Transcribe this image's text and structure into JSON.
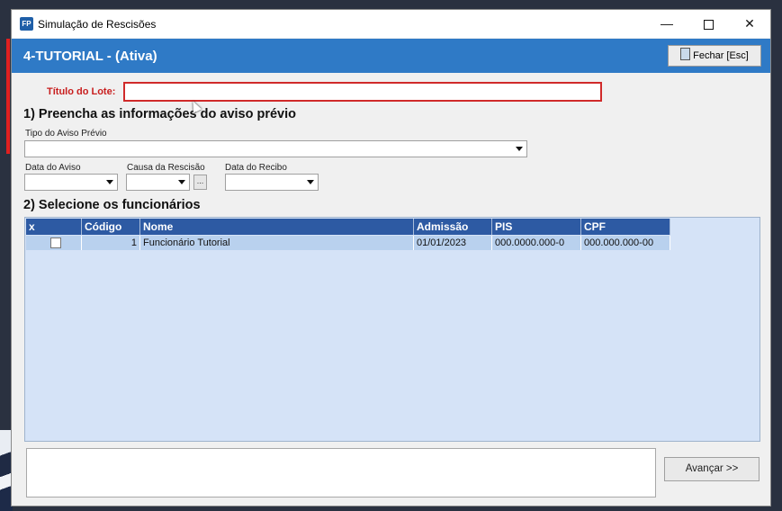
{
  "window": {
    "app_icon_text": "FP",
    "title": "Simulação de Rescisões",
    "minimize_label": "—",
    "close_label": "✕"
  },
  "header": {
    "title": "4-TUTORIAL - (Ativa)",
    "close_button_label": "Fechar [Esc]"
  },
  "form": {
    "lote_label": "Título do Lote:",
    "lote_value": "",
    "section1_title": "1) Preencha as informações do aviso prévio",
    "tipo_aviso_label": "Tipo do Aviso Prévio",
    "tipo_aviso_value": "",
    "data_aviso_label": "Data do Aviso",
    "causa_label": "Causa da Rescisão",
    "causa_button_label": "...",
    "data_recibo_label": "Data do Recibo",
    "section2_title": "2) Selecione os funcionários"
  },
  "table": {
    "columns": [
      "x",
      "Código",
      "Nome",
      "Admissão",
      "PIS",
      "CPF"
    ],
    "rows": [
      {
        "checked": false,
        "codigo": "1",
        "nome": "Funcionário Tutorial",
        "admissao": "01/01/2023",
        "pis": "000.0000.000-0",
        "cpf": "000.000.000-00"
      }
    ]
  },
  "footer": {
    "next_button_label": "Avançar >>"
  },
  "colors": {
    "header_bar": "#2f7ac6",
    "grid_header": "#2d5aa3",
    "grid_background": "#d5e3f7",
    "required_label": "#c81e1e"
  }
}
